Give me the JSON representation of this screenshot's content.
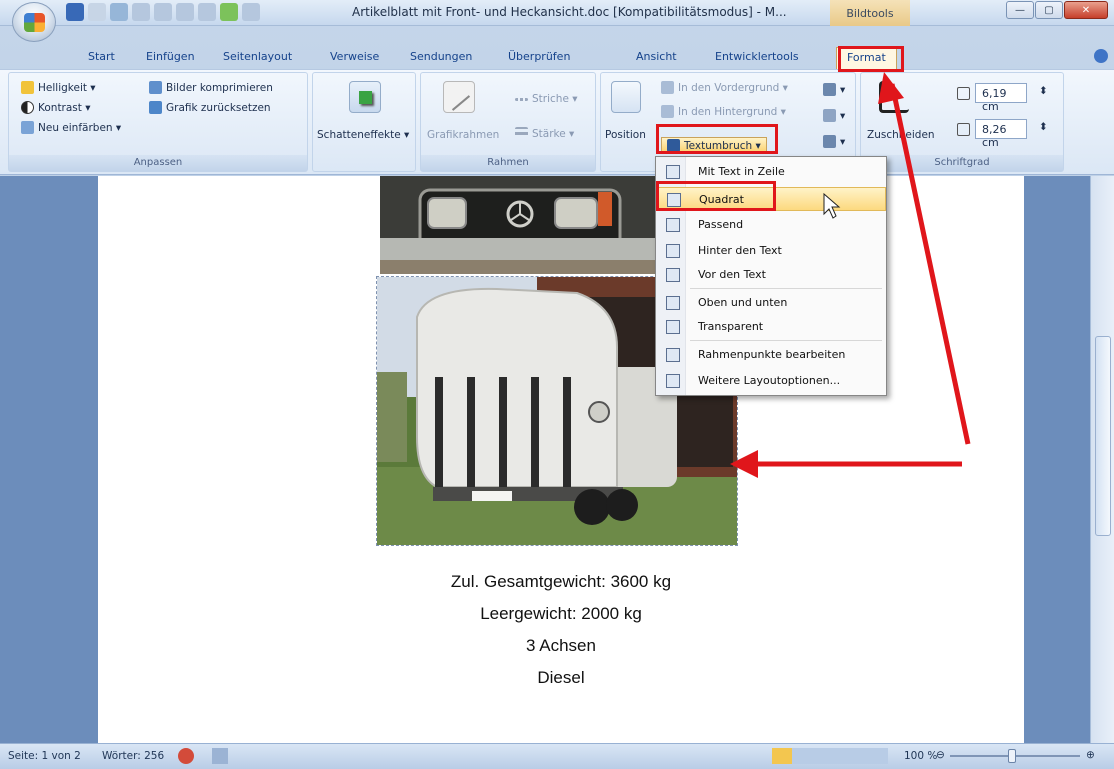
{
  "window": {
    "title": "Artikelblatt mit Front- und Heckansicht.doc [Kompatibilitätsmodus] - M...",
    "context_tab_group": "Bildtools"
  },
  "tabs": [
    "Start",
    "Einfügen",
    "Seitenlayout",
    "Verweise",
    "Sendungen",
    "Überprüfen",
    "Ansicht",
    "Entwicklertools",
    "Format"
  ],
  "active_tab": "Format",
  "ribbon": {
    "anpassen": {
      "label": "Anpassen",
      "helligkeit": "Helligkeit ▾",
      "kontrast": "Kontrast ▾",
      "neu_einfaerben": "Neu einfärben ▾",
      "bilder_komprimieren": "Bilder komprimieren",
      "grafik_zuruecksetzen": "Grafik zurücksetzen"
    },
    "schatteneffekte": {
      "label": "Schatteneffekte ▾"
    },
    "rahmen": {
      "label": "Rahmen",
      "grafikrahmen": "Grafikrahmen",
      "striche": "Striche ▾",
      "staerke": "Stärke ▾"
    },
    "anordnen": {
      "position": "Position",
      "vordergrund": "In den Vordergrund ▾",
      "hintergrund": "In den Hintergrund ▾",
      "textumbruch": "Textumbruch ▾"
    },
    "schriftgrad": {
      "label": "Schriftgrad",
      "zuschneiden": "Zuschneiden",
      "height": "6,19 cm",
      "width": "8,26 cm"
    }
  },
  "menu": {
    "items": [
      "Mit Text in Zeile",
      "Quadrat",
      "Passend",
      "Hinter den Text",
      "Vor den Text",
      "Oben und unten",
      "Transparent",
      "Rahmenpunkte bearbeiten",
      "Weitere Layoutoptionen..."
    ],
    "hovered": "Quadrat"
  },
  "document": {
    "caption_lines": [
      "Zul. Gesamtgewicht: 3600 kg",
      "Leergewicht: 2000 kg",
      "3 Achsen",
      "Diesel"
    ]
  },
  "statusbar": {
    "page": "Seite: 1 von 2",
    "words": "Wörter: 256",
    "zoom": "100 %"
  },
  "colors": {
    "annotation_red": "#e0161b",
    "menu_hover": "#fcd97f",
    "ribbon_bg": "#dbe7f5"
  }
}
